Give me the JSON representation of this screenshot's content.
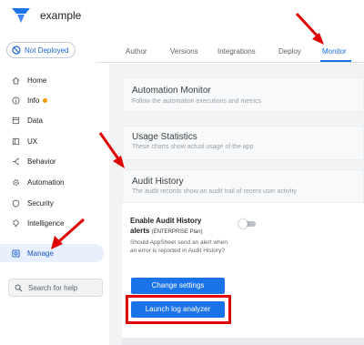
{
  "app": {
    "name": "example"
  },
  "deployment": {
    "status": "Not Deployed"
  },
  "tabs": [
    {
      "label": "Author"
    },
    {
      "label": "Versions"
    },
    {
      "label": "Integrations"
    },
    {
      "label": "Deploy"
    },
    {
      "label": "Monitor",
      "active": true
    }
  ],
  "sidebar": {
    "items": [
      {
        "label": "Home",
        "icon": "home-icon"
      },
      {
        "label": "Info",
        "icon": "info-icon",
        "badge": "dot"
      },
      {
        "label": "Data",
        "icon": "data-icon"
      },
      {
        "label": "UX",
        "icon": "ux-icon"
      },
      {
        "label": "Behavior",
        "icon": "behavior-icon"
      },
      {
        "label": "Automation",
        "icon": "automation-icon"
      },
      {
        "label": "Security",
        "icon": "shield-icon"
      },
      {
        "label": "Intelligence",
        "icon": "lightbulb-icon"
      },
      {
        "label": "Manage",
        "icon": "manage-icon",
        "active": true
      }
    ],
    "search_placeholder": "Search for help"
  },
  "cards": {
    "automation_monitor": {
      "title": "Automation Monitor",
      "subtitle": "Follow the automation executions and metrics"
    },
    "usage_statistics": {
      "title": "Usage Statistics",
      "subtitle": "These charts show actual usage of the app"
    },
    "audit_history": {
      "title": "Audit History",
      "subtitle": "The audit records show an audit trail of recent user activity",
      "toggle_label_line1": "Enable Audit History",
      "toggle_label_line2": "alerts",
      "toggle_label_tag": "(ENTERPRISE Plan)",
      "toggle_description": "Should AppSheet send an alert when an error is reported in Audit History?",
      "toggle_on": false,
      "change_settings_label": "Change settings",
      "launch_log_analyzer_label": "Launch log analyzer"
    }
  },
  "colors": {
    "accent": "#1a73e8",
    "annotation_red": "#e00000",
    "active_nav_bg": "#e8f0fe",
    "badge_orange": "#f29900"
  }
}
